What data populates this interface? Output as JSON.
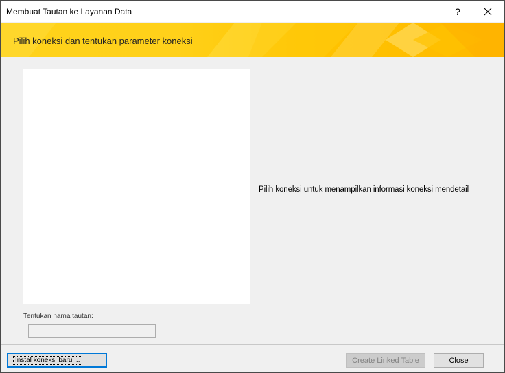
{
  "window": {
    "title": "Membuat Tautan ke Layanan Data",
    "help_label": "?"
  },
  "banner": {
    "heading": "Pilih koneksi dan tentukan parameter koneksi",
    "color_primary": "#ffd21a",
    "color_secondary": "#ffb900"
  },
  "details": {
    "placeholder": "Pilih koneksi untuk menampilkan informasi koneksi mendetail"
  },
  "link_name": {
    "label": "Tentukan nama tautan:",
    "value": ""
  },
  "buttons": {
    "install": "Instal koneksi baru ...",
    "create": "Create Linked Table",
    "close": "Close"
  }
}
